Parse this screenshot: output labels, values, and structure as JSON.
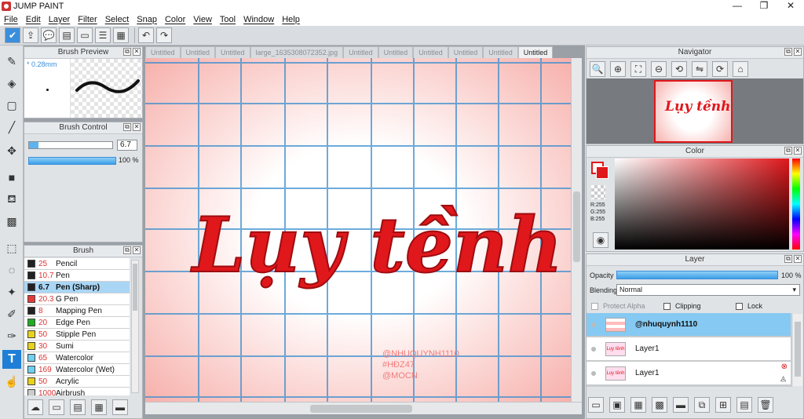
{
  "window": {
    "title": "JUMP PAINT",
    "minimize": "—",
    "maximize": "❐",
    "close": "✕"
  },
  "menu": [
    "File",
    "Edit",
    "Layer",
    "Filter",
    "Select",
    "Snap",
    "Color",
    "View",
    "Tool",
    "Window",
    "Help"
  ],
  "brush_preview": {
    "title": "Brush Preview",
    "size": "* 0.28mm"
  },
  "brush_control": {
    "title": "Brush Control",
    "size_value": "6.7",
    "opacity_value": "100 %"
  },
  "brush": {
    "title": "Brush",
    "items": [
      {
        "size": "25",
        "name": "Pencil",
        "color": "#222222"
      },
      {
        "size": "10.7",
        "name": "Pen",
        "color": "#222222"
      },
      {
        "size": "6.7",
        "name": "Pen (Sharp)",
        "color": "#222222",
        "selected": true
      },
      {
        "size": "20.3",
        "name": "G Pen",
        "color": "#e23b3b"
      },
      {
        "size": "8",
        "name": "Mapping Pen",
        "color": "#222222"
      },
      {
        "size": "20",
        "name": "Edge Pen",
        "color": "#22aa22"
      },
      {
        "size": "50",
        "name": "Stipple Pen",
        "color": "#e8d21c"
      },
      {
        "size": "30",
        "name": "Sumi",
        "color": "#e8d21c"
      },
      {
        "size": "65",
        "name": "Watercolor",
        "color": "#6fd0f0"
      },
      {
        "size": "169",
        "name": "Watercolor (Wet)",
        "color": "#6fd0f0"
      },
      {
        "size": "50",
        "name": "Acrylic",
        "color": "#e8d21c"
      },
      {
        "size": "1000",
        "name": "Airbrush",
        "color": "#cccccc"
      }
    ]
  },
  "tabs": [
    "Untitled",
    "Untitled",
    "Untitled",
    "large_1635308072352.jpg",
    "Untitled",
    "Untitled",
    "Untitled",
    "Untitled",
    "Untitled",
    "Untitled",
    "Untitled"
  ],
  "active_tab_index": 10,
  "canvas": {
    "artwork_text": "Lụy tềnh",
    "watermark": [
      "@NHUQUYNH1110",
      "#HĐZ47",
      "@MOCN"
    ]
  },
  "navigator": {
    "title": "Navigator",
    "thumb_text": "Lụy tềnh"
  },
  "color": {
    "title": "Color",
    "r": "R:255",
    "g": "G:255",
    "b": "B:255",
    "accent": "#e0171b"
  },
  "layer": {
    "title": "Layer",
    "opacity_label": "Opacity",
    "opacity_value": "100 %",
    "blending_label": "Blending",
    "blending_value": "Normal",
    "protect_alpha": "Protect Alpha",
    "clipping": "Clipping",
    "lock": "Lock",
    "layers": [
      {
        "name": "@nhuquynh1110",
        "selected": true
      },
      {
        "name": "Layer1",
        "thumb_text": "Lụy tềnh"
      },
      {
        "name": "Layer1",
        "thumb_text": "Lụy tềnh"
      }
    ]
  }
}
